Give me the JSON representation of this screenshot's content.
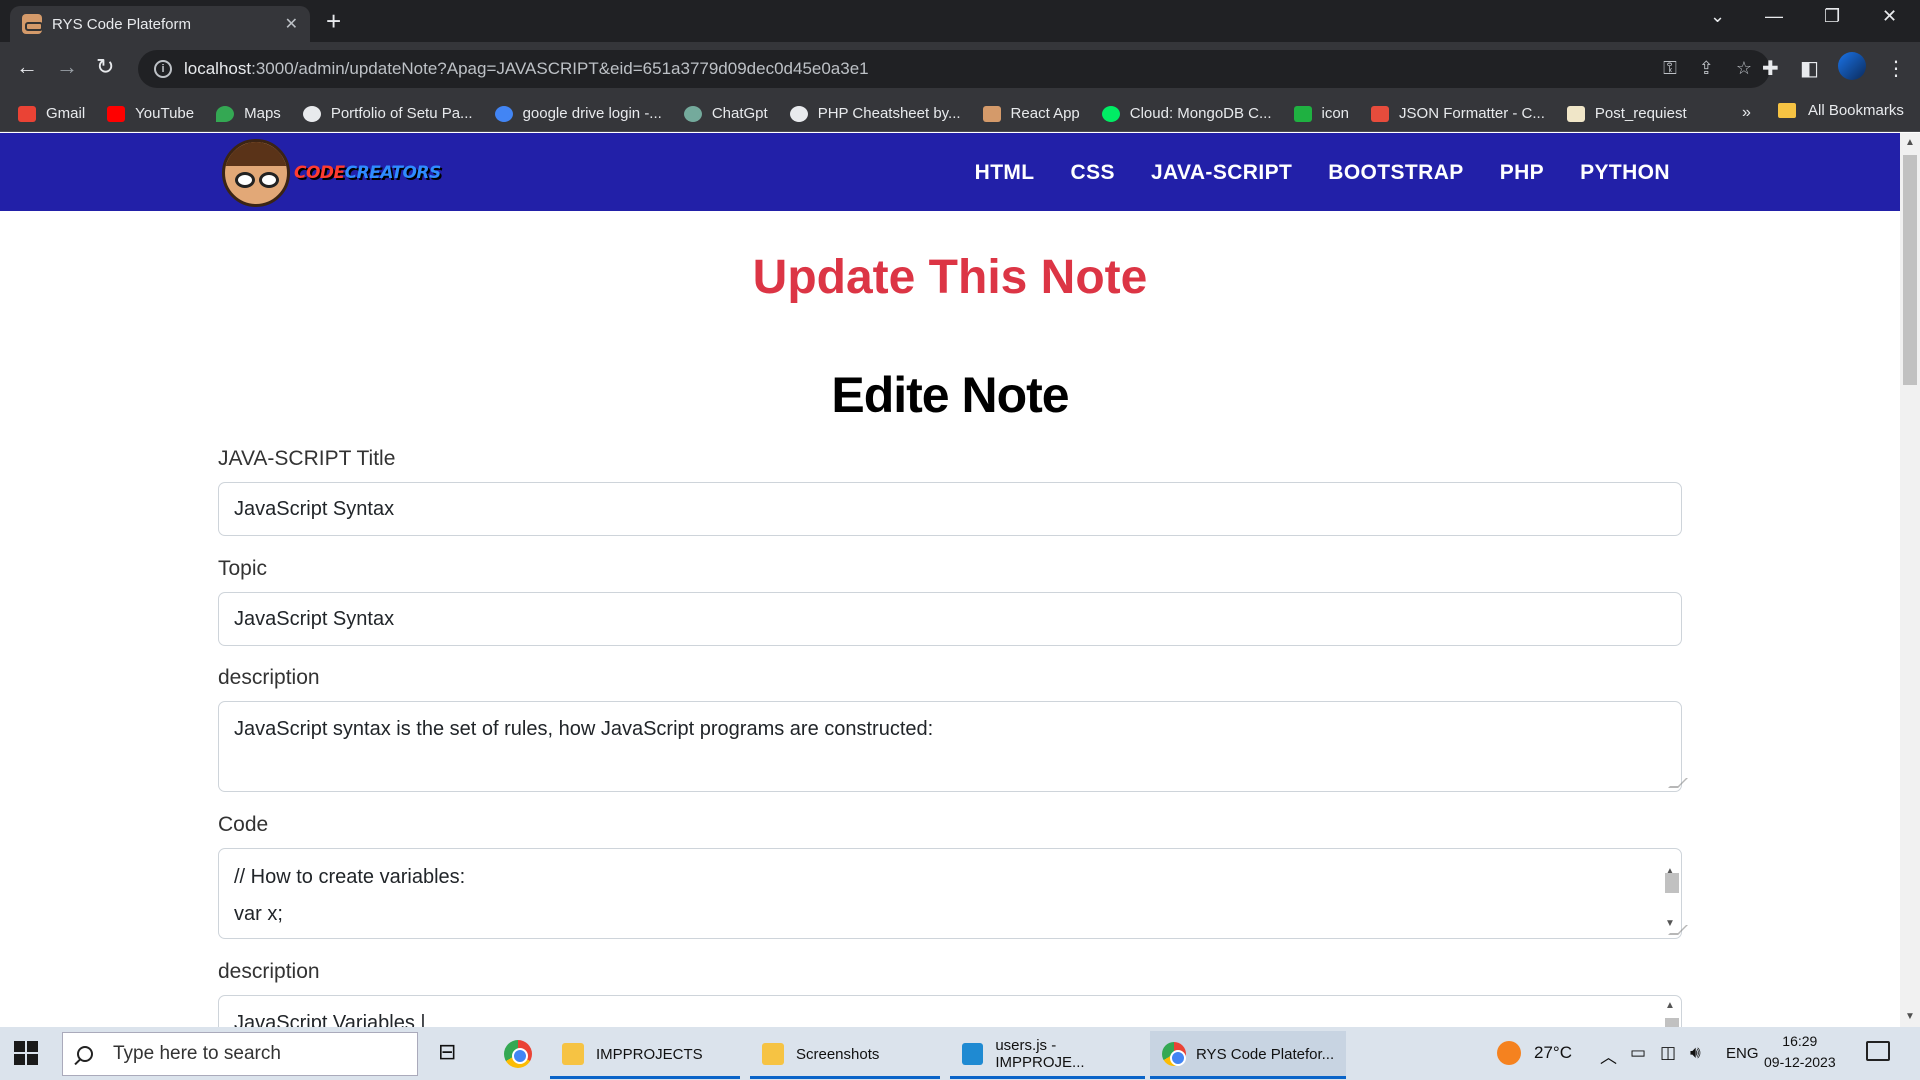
{
  "browser": {
    "tab_title": "RYS Code Plateform",
    "tab_close": "✕",
    "new_tab": "+",
    "url_host": "localhost",
    "url_rest": ":3000/admin/updateNote?Apag=JAVASCRIPT&eid=651a3779d09dec0d45e0a3e1",
    "window_controls": [
      "⌄",
      "—",
      "❐",
      "✕"
    ]
  },
  "bookmarks": {
    "items": [
      {
        "label": "Gmail",
        "color": "#ea4335"
      },
      {
        "label": "YouTube",
        "color": "#ff0000"
      },
      {
        "label": "Maps",
        "color": "#34a853"
      },
      {
        "label": "Portfolio of Setu Pa...",
        "color": "#e8eaed"
      },
      {
        "label": "google drive login -...",
        "color": "#4285f4"
      },
      {
        "label": "ChatGpt",
        "color": "#74aa9c"
      },
      {
        "label": "PHP Cheatsheet by...",
        "color": "#e8eaed"
      },
      {
        "label": "React App",
        "color": "#d49a6a"
      },
      {
        "label": "Cloud: MongoDB C...",
        "color": "#00ed64"
      },
      {
        "label": "icon",
        "color": "#1fb141"
      },
      {
        "label": "JSON Formatter - C...",
        "color": "#e74c3c"
      },
      {
        "label": "Post_requiest",
        "color": "#f0e6c8"
      }
    ],
    "more": "»",
    "all_bookmarks": "All Bookmarks"
  },
  "site": {
    "logo_part1": "CODE",
    "logo_part2": "CREATORS",
    "menu": [
      "HTML",
      "CSS",
      "JAVA-SCRIPT",
      "BOOTSTRAP",
      "PHP",
      "PYTHON"
    ],
    "page_title": "Update This Note",
    "form_title": "Edite Note"
  },
  "form": {
    "title_label": "JAVA-SCRIPT Title",
    "title_value": "JavaScript Syntax",
    "topic_label": "Topic",
    "topic_value": "JavaScript Syntax",
    "description_label": "description",
    "description_value": "JavaScript syntax is the set of rules, how JavaScript programs are constructed:",
    "code_label": "Code",
    "code_line1": "// How to create variables:",
    "code_line2": "var x;",
    "description2_label": "description",
    "description2_value": "JavaScript Variables |"
  },
  "taskbar": {
    "search_placeholder": "Type here to search",
    "apps": [
      {
        "label": "IMPPROJECTS"
      },
      {
        "label": "Screenshots"
      },
      {
        "label": "users.js - IMPPROJE..."
      },
      {
        "label": "RYS Code Platefor..."
      }
    ],
    "temperature": "27°C",
    "language": "ENG",
    "time": "16:29",
    "date": "09-12-2023"
  },
  "colors": {
    "navbar": "#2220a8",
    "page_title": "#dc3545",
    "chrome_dark": "#202124"
  }
}
